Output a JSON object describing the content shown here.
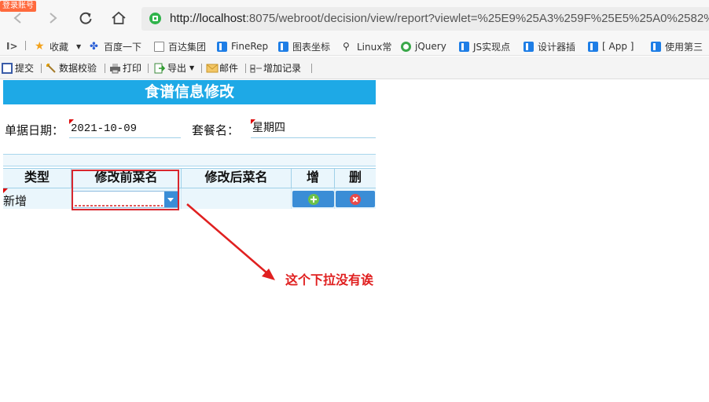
{
  "browser": {
    "login_badge": "登录账号",
    "url_host": "http://localhost",
    "url_rest": ":8075/webroot/decision/view/report?viewlet=%25E9%25A3%259F%25E5%25A0%2582%"
  },
  "bookmarks": [
    {
      "label": "收藏",
      "icon": "star-icon"
    },
    {
      "label": "百度一下",
      "icon": "baidu-paw-icon"
    },
    {
      "label": "百达集团",
      "icon": "page-icon"
    },
    {
      "label": "FineRep",
      "icon": "finereport-icon"
    },
    {
      "label": "图表坐标",
      "icon": "finereport-icon"
    },
    {
      "label": "Linux常",
      "icon": "linux-icon"
    },
    {
      "label": "jQuery",
      "icon": "jquery-icon"
    },
    {
      "label": "JS实现点",
      "icon": "finereport-icon"
    },
    {
      "label": "设计器插",
      "icon": "finereport-icon"
    },
    {
      "label": "[ App ]",
      "icon": "finereport-icon"
    },
    {
      "label": "使用第三",
      "icon": "finereport-icon"
    }
  ],
  "toolbar": {
    "submit": "提交",
    "validate": "数据校验",
    "print": "打印",
    "export": "导出",
    "mail": "邮件",
    "add_record": "增加记录"
  },
  "report": {
    "title": "食谱信息修改",
    "date_label": "单据日期：",
    "date_value": "2021-10-09",
    "meal_label": "套餐名：",
    "meal_value": "星期四",
    "columns": [
      "类型",
      "修改前菜名",
      "修改后菜名",
      "增",
      "删"
    ],
    "row": {
      "type": "新增",
      "before_name": "",
      "after_name": ""
    }
  },
  "annotation": {
    "text": "这个下拉没有诶",
    "color": "#e02020"
  },
  "colors": {
    "title_bar": "#1ea9e6",
    "highlight": "#d9272e"
  }
}
